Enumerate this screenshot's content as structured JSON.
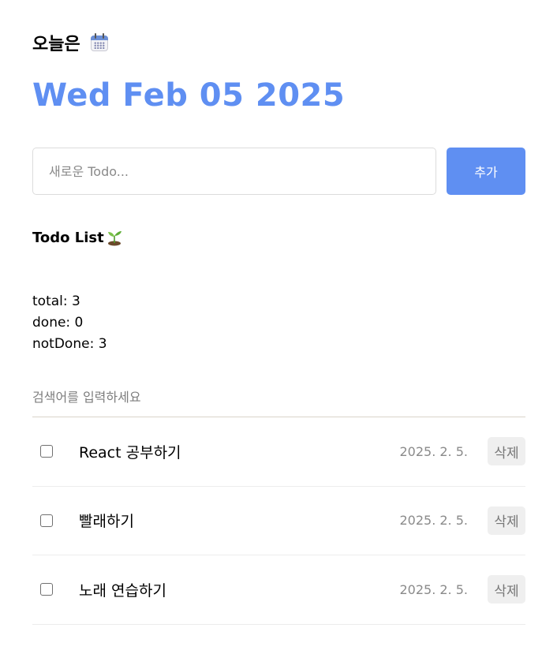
{
  "header": {
    "title": "오늘은",
    "title_icon": "calendar-icon",
    "date": "Wed Feb 05 2025"
  },
  "editor": {
    "placeholder": "새로운 Todo...",
    "value": "",
    "add_label": "추가"
  },
  "list": {
    "title": "Todo List",
    "title_icon": "sprout-icon",
    "stats": {
      "total": "total: 3",
      "done": "done: 0",
      "not_done": "notDone: 3"
    },
    "search_placeholder": "검색어를 입력하세요",
    "items": [
      {
        "content": "React 공부하기",
        "date": "2025. 2. 5.",
        "checked": false,
        "delete_label": "삭제"
      },
      {
        "content": "빨래하기",
        "date": "2025. 2. 5.",
        "checked": false,
        "delete_label": "삭제"
      },
      {
        "content": "노래 연습하기",
        "date": "2025. 2. 5.",
        "checked": false,
        "delete_label": "삭제"
      }
    ]
  },
  "colors": {
    "accent": "#5f8ff2",
    "delete_bg": "#efefef",
    "date_text": "#8a8a8a"
  }
}
